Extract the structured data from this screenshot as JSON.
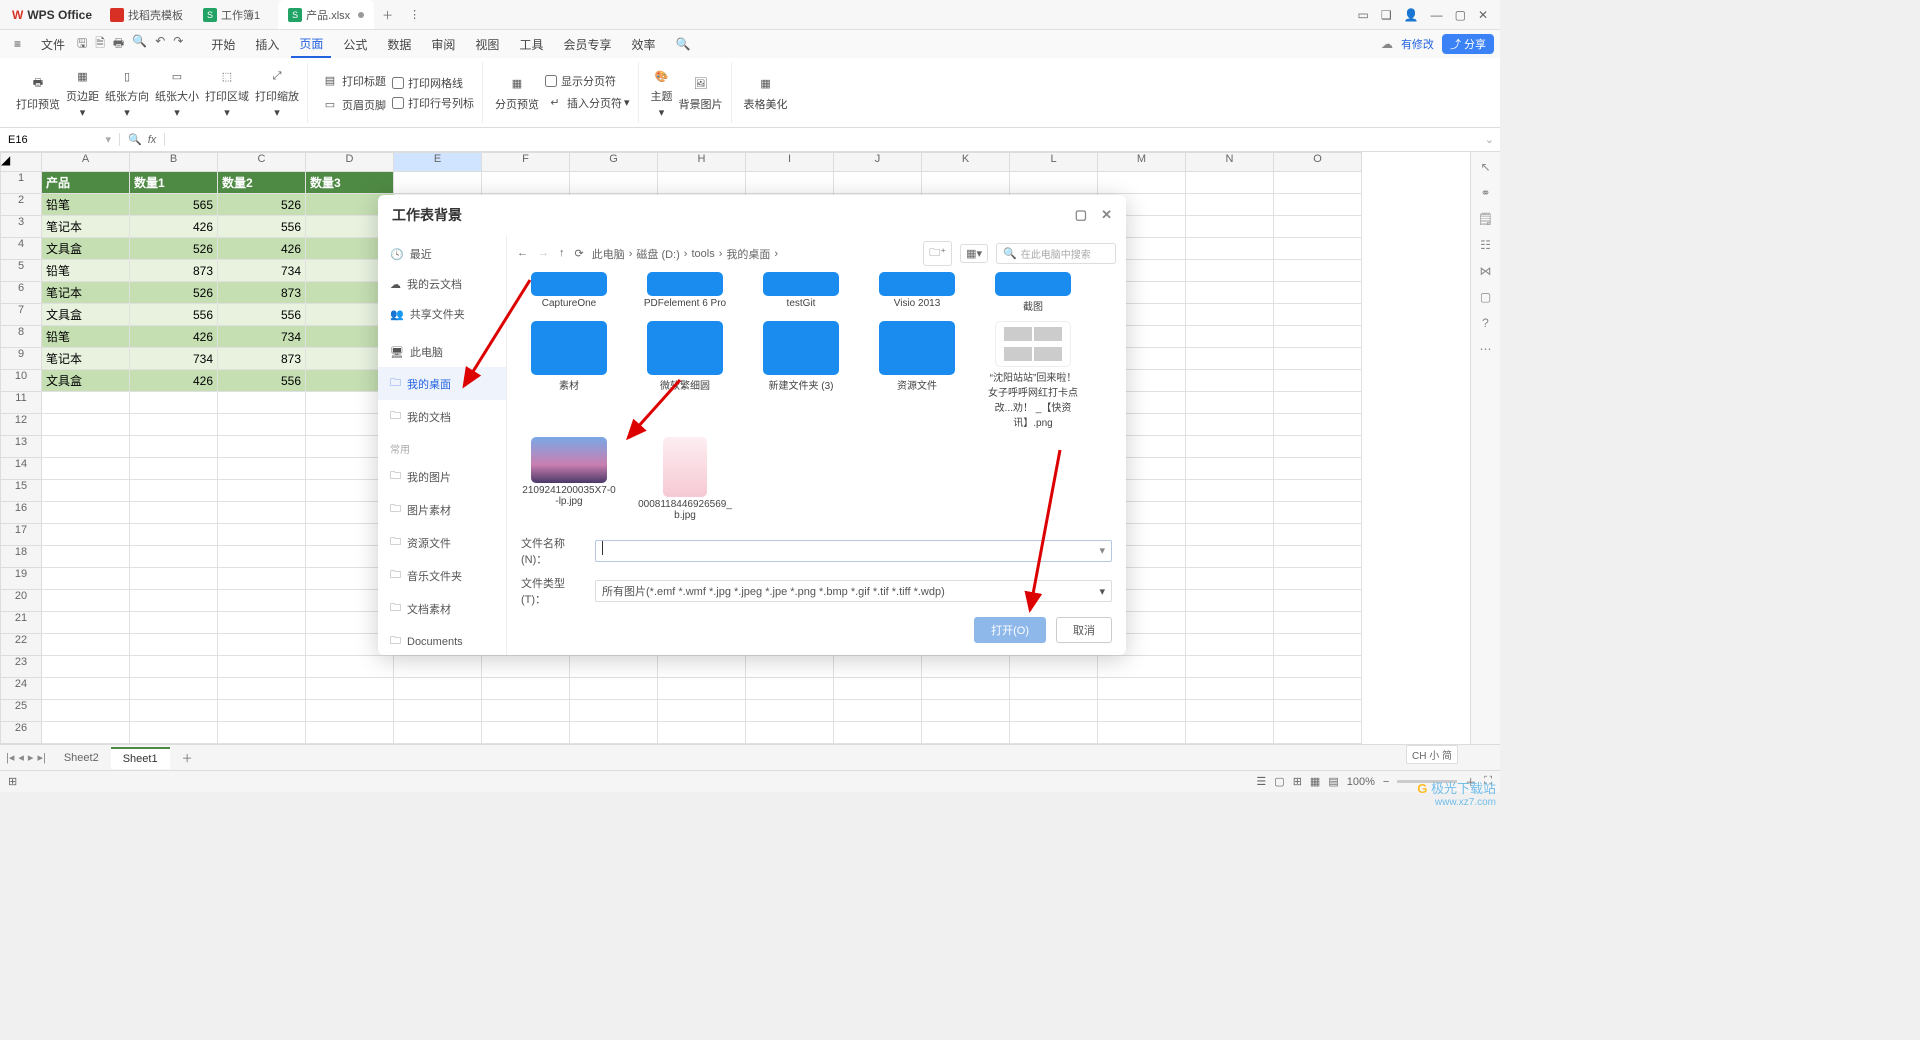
{
  "titlebar": {
    "app_name": "WPS Office",
    "tabs": [
      {
        "label": "找稻壳模板",
        "icon_color": "#d93025"
      },
      {
        "label": "工作簿1",
        "icon_letter": "S",
        "icon_bg": "#22a366"
      },
      {
        "label": "产品.xlsx",
        "icon_letter": "S",
        "icon_bg": "#22a366",
        "modified": true
      }
    ],
    "window_controls": [
      "min",
      "max",
      "close"
    ]
  },
  "menubar": {
    "file_label": "文件",
    "items": [
      "开始",
      "插入",
      "页面",
      "公式",
      "数据",
      "审阅",
      "视图",
      "工具",
      "会员专享",
      "效率"
    ],
    "active_index": 2,
    "modified_label": "有修改",
    "share_label": "分享"
  },
  "ribbon": {
    "print_preview": "打印预览",
    "margin": "页边距",
    "orientation": "纸张方向",
    "size": "纸张大小",
    "print_area": "打印区域",
    "print_scale": "打印缩放",
    "print_title": "打印标题",
    "header_footer": "页眉页脚",
    "print_gridlines": "打印网格线",
    "print_rowcol": "打印行号列标",
    "page_break_preview": "分页预览",
    "insert_break": "插入分页符",
    "show_break": "显示分页符",
    "theme": "主题",
    "bg_image": "背景图片",
    "beautify": "表格美化"
  },
  "formula_bar": {
    "cell_ref": "E16",
    "fx_label": "fx"
  },
  "grid": {
    "columns": [
      "A",
      "B",
      "C",
      "D",
      "E",
      "F",
      "G",
      "H",
      "I",
      "J",
      "K",
      "L",
      "M",
      "N",
      "O"
    ],
    "selected_col_index": 4,
    "row_count": 26,
    "header_row": [
      "产品",
      "数量1",
      "数量2",
      "数量3"
    ],
    "data_rows": [
      [
        "铅笔",
        "565",
        "526",
        ""
      ],
      [
        "笔记本",
        "426",
        "556",
        ""
      ],
      [
        "文具盒",
        "526",
        "426",
        ""
      ],
      [
        "铅笔",
        "873",
        "734",
        ""
      ],
      [
        "笔记本",
        "526",
        "873",
        ""
      ],
      [
        "文具盒",
        "556",
        "556",
        ""
      ],
      [
        "铅笔",
        "426",
        "734",
        ""
      ],
      [
        "笔记本",
        "734",
        "873",
        ""
      ],
      [
        "文具盒",
        "426",
        "556",
        ""
      ]
    ],
    "selected_row": 16,
    "selected_col": "E"
  },
  "sheets": {
    "tabs": [
      "Sheet2",
      "Sheet1"
    ],
    "active_index": 1
  },
  "statusbar": {
    "zoom": "100%",
    "ime": "CH 小 简"
  },
  "dialog": {
    "title": "工作表背景",
    "sidebar": {
      "recent": "最近",
      "mycloud": "我的云文档",
      "shared": "共享文件夹",
      "thispc": "此电脑",
      "desktop": "我的桌面",
      "mydocs": "我的文档",
      "common_label": "常用",
      "common_items": [
        "我的图片",
        "图片素材",
        "资源文件",
        "音乐文件夹",
        "文档素材",
        "Documents"
      ]
    },
    "toolbar": {
      "breadcrumbs": [
        "此电脑",
        "磁盘 (D:)",
        "tools",
        "我的桌面"
      ],
      "search_placeholder": "在此电脑中搜索"
    },
    "files": [
      {
        "name": "CaptureOne",
        "type": "folder-partial"
      },
      {
        "name": "PDFelement 6 Pro",
        "type": "folder-partial"
      },
      {
        "name": "testGit",
        "type": "folder-partial"
      },
      {
        "name": "Visio 2013",
        "type": "folder-partial"
      },
      {
        "name": "截图",
        "type": "folder-partial"
      },
      {
        "name": "素材",
        "type": "folder"
      },
      {
        "name": "微软繁细圆",
        "type": "folder"
      },
      {
        "name": "新建文件夹 (3)",
        "type": "folder"
      },
      {
        "name": "资源文件",
        "type": "folder"
      },
      {
        "name": "“沈阳站站”回来啦！女子呼呼网红打卡点改...劝！ _【快资讯】.png",
        "type": "thumb3"
      },
      {
        "name": "2109241200035X7-0-lp.jpg",
        "type": "thumb1"
      },
      {
        "name": "0008118446926569_b.jpg",
        "type": "thumb2"
      }
    ],
    "filename_label": "文件名称(N)：",
    "filetype_label": "文件类型(T)：",
    "filetype_value": "所有图片(*.emf *.wmf *.jpg *.jpeg *.jpe *.png *.bmp *.gif *.tif *.tiff *.wdp)",
    "open_btn": "打开(O)",
    "cancel_btn": "取消"
  },
  "watermark": {
    "brand": "极光下载站",
    "url": "www.xz7.com"
  }
}
